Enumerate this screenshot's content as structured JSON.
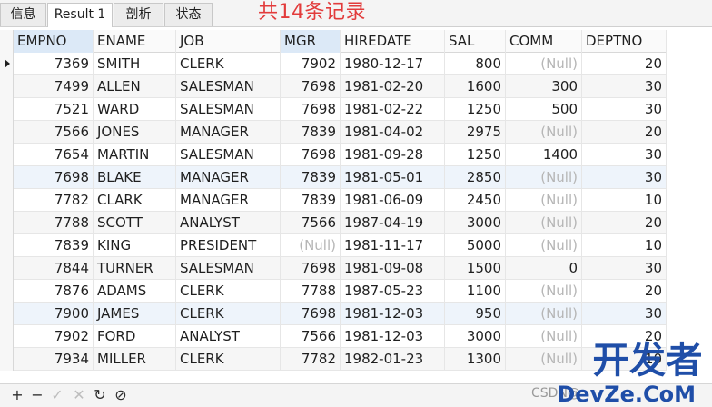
{
  "tabs": [
    {
      "label": "信息"
    },
    {
      "label": "Result 1"
    },
    {
      "label": "剖析"
    },
    {
      "label": "状态"
    }
  ],
  "annotation": "共14条记录",
  "columns": [
    "EMPNO",
    "ENAME",
    "JOB",
    "MGR",
    "HIREDATE",
    "SAL",
    "COMM",
    "DEPTNO"
  ],
  "null_text": "(Null)",
  "rows": [
    {
      "empno": "7369",
      "ename": "SMITH",
      "job": "CLERK",
      "mgr": "7902",
      "hiredate": "1980-12-17",
      "sal": "800",
      "comm": "(Null)",
      "deptno": "20"
    },
    {
      "empno": "7499",
      "ename": "ALLEN",
      "job": "SALESMAN",
      "mgr": "7698",
      "hiredate": "1981-02-20",
      "sal": "1600",
      "comm": "300",
      "deptno": "30"
    },
    {
      "empno": "7521",
      "ename": "WARD",
      "job": "SALESMAN",
      "mgr": "7698",
      "hiredate": "1981-02-22",
      "sal": "1250",
      "comm": "500",
      "deptno": "30"
    },
    {
      "empno": "7566",
      "ename": "JONES",
      "job": "MANAGER",
      "mgr": "7839",
      "hiredate": "1981-04-02",
      "sal": "2975",
      "comm": "(Null)",
      "deptno": "20"
    },
    {
      "empno": "7654",
      "ename": "MARTIN",
      "job": "SALESMAN",
      "mgr": "7698",
      "hiredate": "1981-09-28",
      "sal": "1250",
      "comm": "1400",
      "deptno": "30"
    },
    {
      "empno": "7698",
      "ename": "BLAKE",
      "job": "MANAGER",
      "mgr": "7839",
      "hiredate": "1981-05-01",
      "sal": "2850",
      "comm": "(Null)",
      "deptno": "30"
    },
    {
      "empno": "7782",
      "ename": "CLARK",
      "job": "MANAGER",
      "mgr": "7839",
      "hiredate": "1981-06-09",
      "sal": "2450",
      "comm": "(Null)",
      "deptno": "10"
    },
    {
      "empno": "7788",
      "ename": "SCOTT",
      "job": "ANALYST",
      "mgr": "7566",
      "hiredate": "1987-04-19",
      "sal": "3000",
      "comm": "(Null)",
      "deptno": "20"
    },
    {
      "empno": "7839",
      "ename": "KING",
      "job": "PRESIDENT",
      "mgr": "(Null)",
      "hiredate": "1981-11-17",
      "sal": "5000",
      "comm": "(Null)",
      "deptno": "10"
    },
    {
      "empno": "7844",
      "ename": "TURNER",
      "job": "SALESMAN",
      "mgr": "7698",
      "hiredate": "1981-09-08",
      "sal": "1500",
      "comm": "0",
      "deptno": "30"
    },
    {
      "empno": "7876",
      "ename": "ADAMS",
      "job": "CLERK",
      "mgr": "7788",
      "hiredate": "1987-05-23",
      "sal": "1100",
      "comm": "(Null)",
      "deptno": "20"
    },
    {
      "empno": "7900",
      "ename": "JAMES",
      "job": "CLERK",
      "mgr": "7698",
      "hiredate": "1981-12-03",
      "sal": "950",
      "comm": "(Null)",
      "deptno": "30"
    },
    {
      "empno": "7902",
      "ename": "FORD",
      "job": "ANALYST",
      "mgr": "7566",
      "hiredate": "1981-12-03",
      "sal": "3000",
      "comm": "(Null)",
      "deptno": "20"
    },
    {
      "empno": "7934",
      "ename": "MILLER",
      "job": "CLERK",
      "mgr": "7782",
      "hiredate": "1982-01-23",
      "sal": "1300",
      "comm": "(Null)",
      "deptno": "10"
    }
  ],
  "toolbar": [
    {
      "name": "add-record-button",
      "glyph": "+",
      "enabled": true
    },
    {
      "name": "delete-record-button",
      "glyph": "−",
      "enabled": true
    },
    {
      "name": "apply-changes-button",
      "glyph": "✓",
      "enabled": false
    },
    {
      "name": "discard-changes-button",
      "glyph": "✕",
      "enabled": false
    },
    {
      "name": "refresh-button",
      "glyph": "↻",
      "enabled": true
    },
    {
      "name": "stop-button",
      "glyph": "⊘",
      "enabled": true
    }
  ],
  "watermark": {
    "brand": "开发者",
    "domain": "DevZe.CoM",
    "csdn": "CSDN@"
  },
  "colors": {
    "annotation": "#e23b3b",
    "watermark": "#1f4ea8",
    "null_text": "#b6b6b6",
    "selected_header": "#dce9f7"
  }
}
